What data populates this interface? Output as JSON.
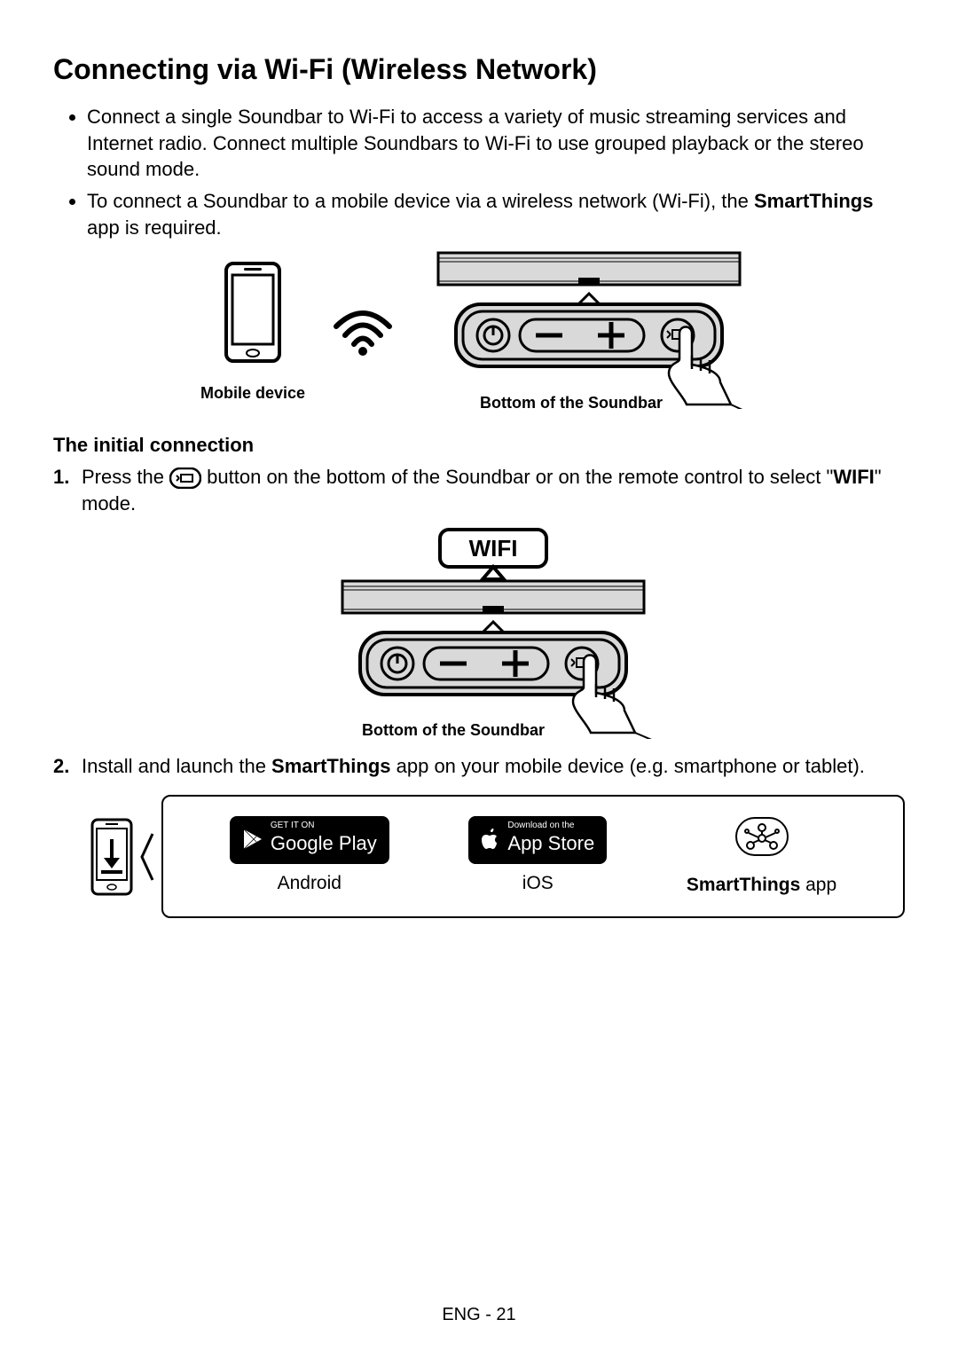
{
  "title": "Connecting via Wi-Fi (Wireless Network)",
  "bullets": {
    "b1": "Connect a single Soundbar to Wi-Fi to access a variety of music streaming services and Internet radio. Connect multiple Soundbars to Wi-Fi to use grouped playback or the stereo sound mode.",
    "b2_before": "To connect a Soundbar to a mobile device via a wireless network (Wi-Fi), the ",
    "b2_bold": "SmartThings",
    "b2_after": " app is required."
  },
  "labels": {
    "mobile_device": "Mobile device",
    "bottom_soundbar": "Bottom of the Soundbar"
  },
  "subheading": "The initial connection",
  "step1": {
    "before": "Press the ",
    "mid": " button on the bottom of the Soundbar or on the remote control to select \"",
    "wifi": "WIFI",
    "after": "\" mode."
  },
  "wifi_bubble": "WIFI",
  "step2": {
    "before": "Install and launch the ",
    "bold": "SmartThings",
    "after": " app on your mobile device (e.g. smartphone or tablet)."
  },
  "stores": {
    "gp_small": "GET IT ON",
    "gp_big": "Google Play",
    "gp_label": "Android",
    "as_small": "Download on the",
    "as_big": "App Store",
    "as_label": "iOS",
    "st_bold": "SmartThings",
    "st_after": " app"
  },
  "footer": "ENG - 21"
}
